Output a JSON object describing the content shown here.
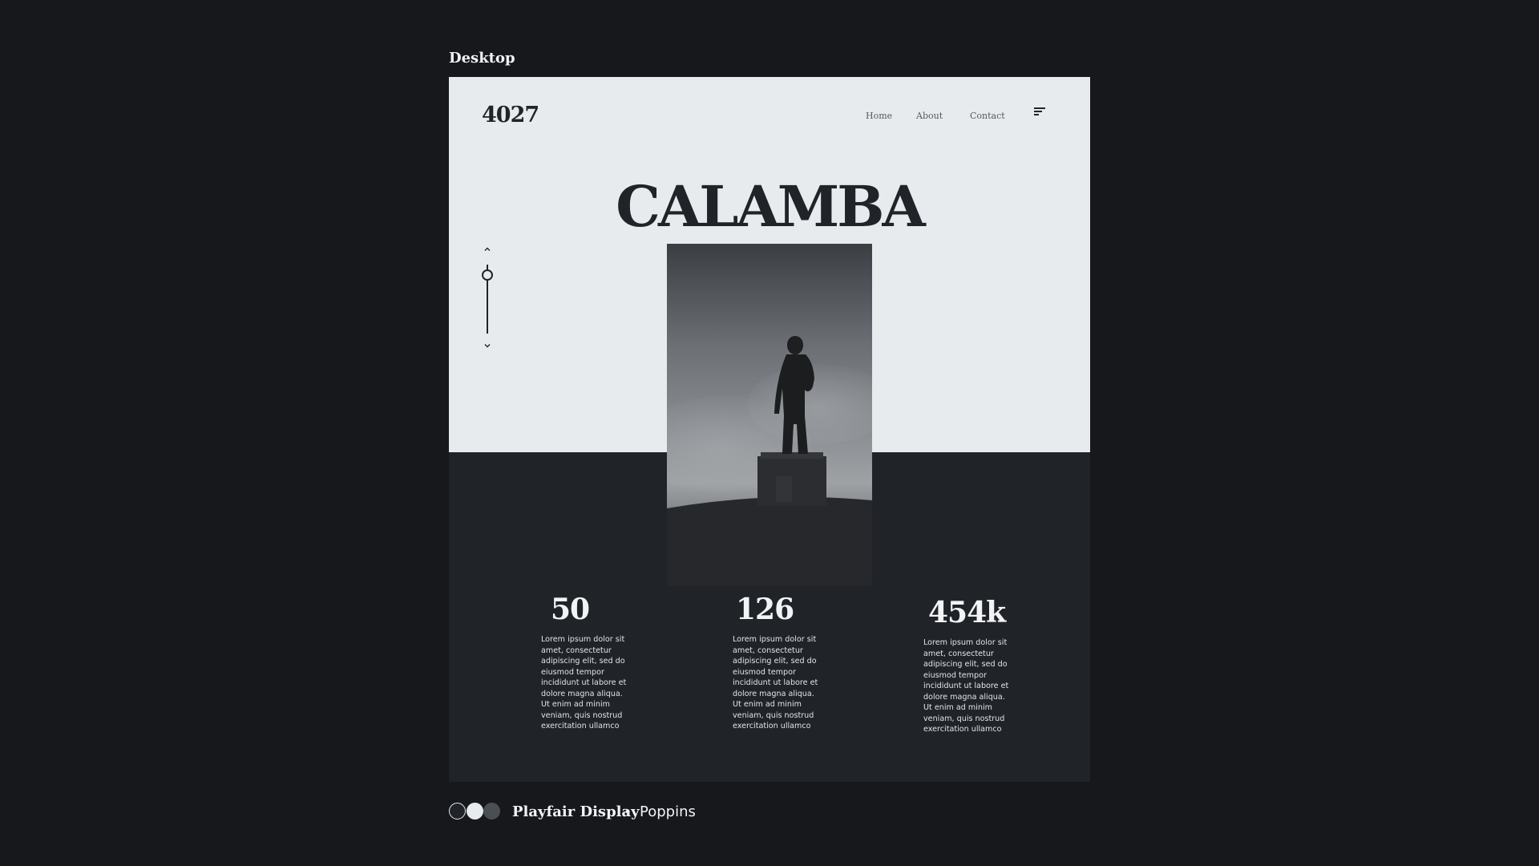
{
  "frame_label": "Desktop",
  "site": {
    "logo": "4027",
    "nav": [
      "Home",
      "About",
      "Contact"
    ],
    "menu_icon": "menu-icon",
    "hero_title": "CALAMBA",
    "slider": {
      "up_icon": "chevron-up-icon",
      "down_icon": "chevron-down-icon",
      "position": 0.15
    },
    "image_subject": "statue silhouette against cloudy sky",
    "stats": [
      {
        "value": "50",
        "text": "Lorem ipsum dolor sit amet, consectetur adipiscing elit, sed do eiusmod tempor incididunt ut labore et dolore magna aliqua. Ut enim ad minim veniam, quis nostrud exercitation ullamco"
      },
      {
        "value": "126",
        "text": "Lorem ipsum dolor sit amet, consectetur adipiscing elit, sed do eiusmod tempor incididunt ut labore et dolore magna aliqua. Ut enim ad minim veniam, quis nostrud exercitation ullamco"
      },
      {
        "value": "454k",
        "text": "Lorem ipsum dolor sit amet, consectetur adipiscing elit, sed do eiusmod tempor incididunt ut labore et dolore magna aliqua. Ut enim ad minim veniam, quis nostrud exercitation ullamco"
      }
    ]
  },
  "palette": {
    "swatches": [
      "#202328",
      "#e8ebee",
      "#4a4e55"
    ],
    "fonts": [
      "Playfair Display",
      "Poppins"
    ],
    "separator": "•"
  }
}
